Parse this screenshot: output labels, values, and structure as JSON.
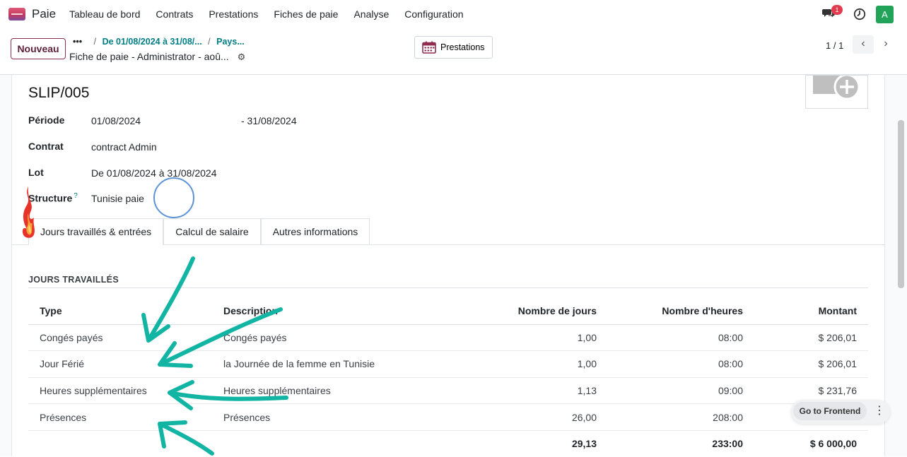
{
  "nav": {
    "app_name": "Paie",
    "menu": [
      "Tableau de bord",
      "Contrats",
      "Prestations",
      "Fiches de paie",
      "Analyse",
      "Configuration"
    ],
    "chat_badge": "1",
    "avatar_initial": "A"
  },
  "control_panel": {
    "new_button": "Nouveau",
    "breadcrumb_dots": "•••",
    "breadcrumb_items": [
      "De 01/08/2024 à 31/08/...",
      "Pays..."
    ],
    "current_record": "Fiche de paie - Administrator - aoû...",
    "prestations_button": "Prestations",
    "pager": "1 / 1"
  },
  "form": {
    "title": "SLIP/005",
    "fields": {
      "periode_label": "Période",
      "periode_start": "01/08/2024",
      "periode_end": "- 31/08/2024",
      "contrat_label": "Contrat",
      "contrat_value": "contract Admin",
      "lot_label": "Lot",
      "lot_value": "De 01/08/2024 à 31/08/2024",
      "structure_label": "Structure",
      "structure_help": "?",
      "structure_value": "Tunisie paie"
    },
    "tabs": [
      "Jours travaillés & entrées",
      "Calcul de salaire",
      "Autres informations"
    ],
    "section_title": "JOURS TRAVAILLÉS",
    "table": {
      "headers": [
        "Type",
        "Description",
        "Nombre de jours",
        "Nombre d'heures",
        "Montant"
      ],
      "rows": [
        [
          "Congés payés",
          "Congés payés",
          "1,00",
          "08:00",
          "$ 206,01"
        ],
        [
          "Jour Férié",
          "la Journée de la femme en Tunisie",
          "1,00",
          "08:00",
          "$ 206,01"
        ],
        [
          "Heures supplémentaires",
          "Heures supplémentaires",
          "1,13",
          "09:00",
          "$ 231,76"
        ],
        [
          "Présences",
          "Présences",
          "26,00",
          "208:00",
          ""
        ]
      ],
      "totals": [
        "",
        "",
        "29,13",
        "233:00",
        "$ 6 000,00"
      ]
    }
  },
  "floating": {
    "frontend_button": "Go to Frontend"
  },
  "colors": {
    "accent": "#017e84",
    "brand": "#714b67",
    "annotation_arrows": "#12b5a4",
    "click_circle": "#5c93d6"
  }
}
